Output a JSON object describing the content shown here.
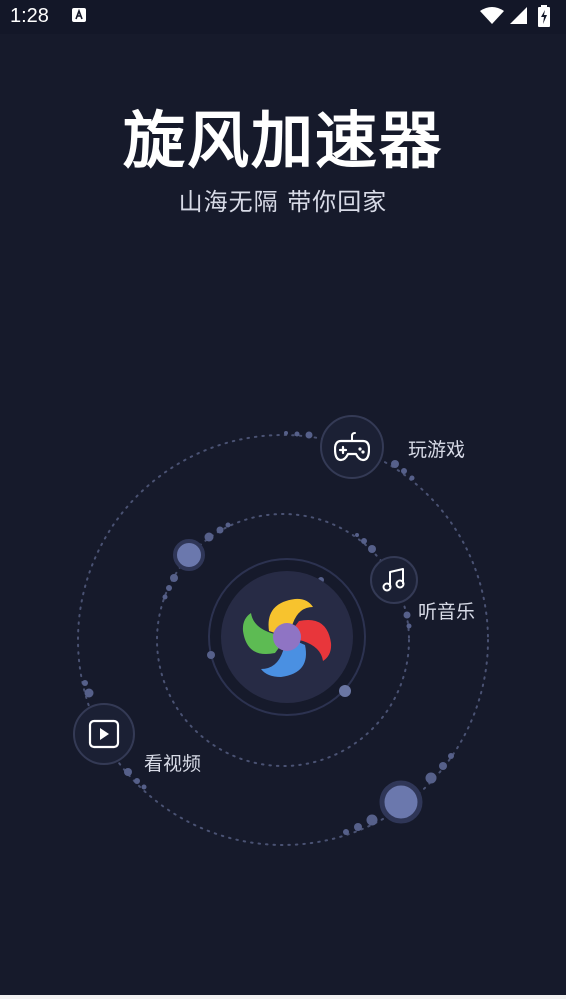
{
  "status_bar": {
    "time": "1:28",
    "icons": [
      "notification-a-icon",
      "wifi-icon",
      "signal-icon",
      "battery-charging-icon"
    ]
  },
  "header": {
    "title": "旋风加速器",
    "subtitle": "山海无隔  带你回家"
  },
  "features": [
    {
      "label": "玩游戏",
      "icon": "gamepad-icon"
    },
    {
      "label": "听音乐",
      "icon": "music-note-icon"
    },
    {
      "label": "看视频",
      "icon": "play-video-icon"
    }
  ],
  "center": {
    "icon": "app-logo-pinwheel"
  },
  "colors": {
    "background": "#161a2b",
    "orbit_dot": "#5d688f",
    "logo_yellow": "#f7c32e",
    "logo_red": "#e8363b",
    "logo_blue": "#4a90e2",
    "logo_green": "#5dbb53",
    "logo_purple": "#8f74c4"
  }
}
